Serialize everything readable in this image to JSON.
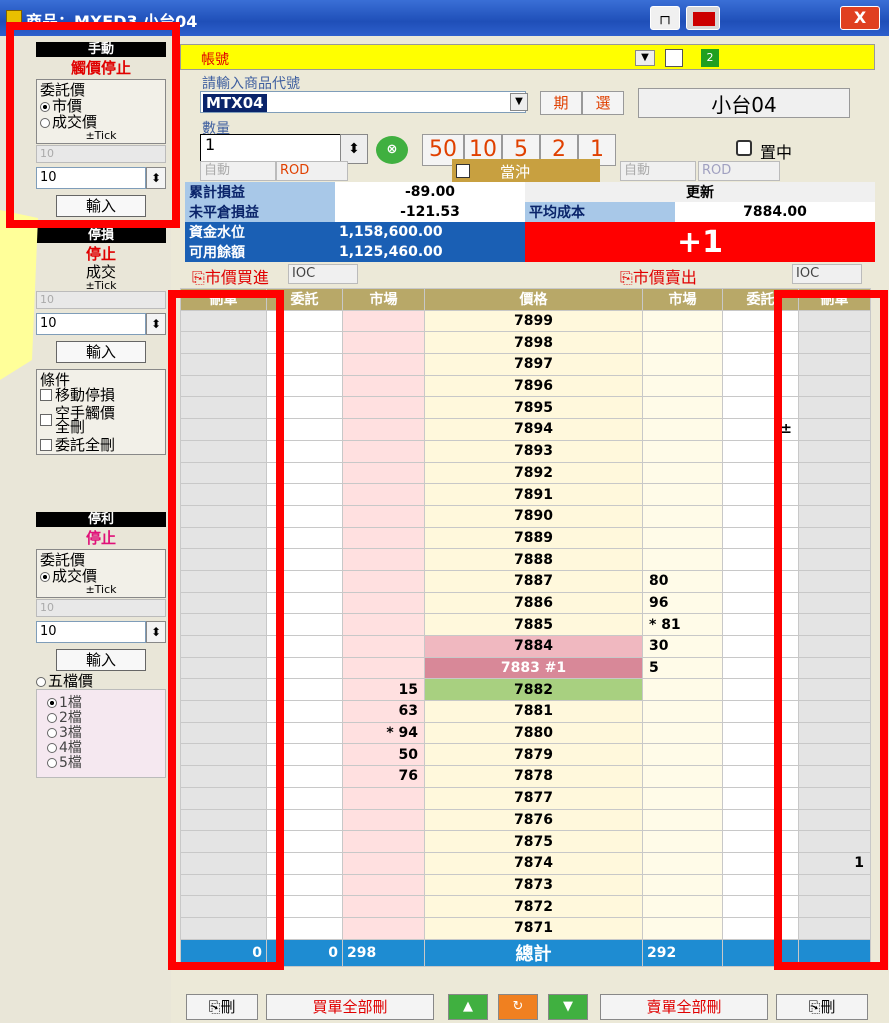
{
  "window": {
    "title": "商品：MXFD3 小台04",
    "pin_label": "",
    "close_label": "X"
  },
  "left": {
    "manual": {
      "header": "手動",
      "sub": "觸價停止",
      "price_caption": "委託價",
      "opt1": "市價",
      "opt2": "成交價",
      "tick": "±Tick",
      "tick_value": "10",
      "step_value": "10",
      "enter": "輸入"
    },
    "stoploss": {
      "header": "停損",
      "sub": "停止",
      "caption": "成交",
      "tick": "±Tick",
      "tick_value": "10",
      "step_value": "10",
      "enter": "輸入",
      "cond_caption": "條件",
      "c1": "移動停損",
      "c2": "空手觸價全刪",
      "c3": "委託全刪"
    },
    "takeprofit": {
      "header": "停利",
      "sub": "停止",
      "price_caption": "委託價",
      "opt1": "成交價",
      "tick": "±Tick",
      "tick_value": "10",
      "step_value": "10",
      "enter": "輸入",
      "opt2": "五檔價",
      "levels": [
        "1檔",
        "2檔",
        "3檔",
        "4檔",
        "5檔"
      ]
    }
  },
  "order": {
    "account_label": "帳號",
    "code_caption": "請輸入商品代號",
    "code_value": "MTX04",
    "btn_period": "期",
    "btn_select": "選",
    "product_name": "小台04",
    "qty_caption": "數量",
    "qty_value": "1",
    "qty_buttons": [
      "50",
      "10",
      "5",
      "2",
      "1"
    ],
    "center_label": "置中",
    "auto1": "自動",
    "rod1": "ROD",
    "daytrade": "當沖",
    "auto2": "自動",
    "rod2": "ROD",
    "stats": {
      "pl_label": "累計損益",
      "pl_value": "-89.00",
      "refresh": "更新",
      "unreal_label": "未平倉損益",
      "unreal_value": "-121.53",
      "avg_label": "平均成本",
      "avg_value": "7884.00",
      "margin_label": "資金水位",
      "margin_value": "1,158,600.00",
      "avail_label": "可用餘額",
      "avail_value": "1,125,460.00",
      "position": "+1"
    },
    "mkt_buy": "市價買進",
    "ioc1": "IOC",
    "mkt_sell": "市價賣出",
    "ioc2": "IOC"
  },
  "book": {
    "headers": [
      "刪單",
      "委託",
      "市場",
      "價格",
      "市場",
      "委託",
      "刪單"
    ],
    "rows": [
      [
        "",
        "",
        "",
        "7899",
        "",
        "",
        ""
      ],
      [
        "",
        "",
        "",
        "7898",
        "",
        "",
        ""
      ],
      [
        "",
        "",
        "",
        "7897",
        "",
        "",
        ""
      ],
      [
        "",
        "",
        "",
        "7896",
        "",
        "",
        ""
      ],
      [
        "",
        "",
        "",
        "7895",
        "",
        "",
        ""
      ],
      [
        "",
        "",
        "",
        "7894",
        "",
        "±",
        ""
      ],
      [
        "",
        "",
        "",
        "7893",
        "",
        "",
        ""
      ],
      [
        "",
        "",
        "",
        "7892",
        "",
        "",
        ""
      ],
      [
        "",
        "",
        "",
        "7891",
        "",
        "",
        ""
      ],
      [
        "",
        "",
        "",
        "7890",
        "",
        "",
        ""
      ],
      [
        "",
        "",
        "",
        "7889",
        "",
        "",
        ""
      ],
      [
        "",
        "",
        "",
        "7888",
        "",
        "",
        ""
      ],
      [
        "",
        "",
        "",
        "7887",
        "80",
        "",
        ""
      ],
      [
        "",
        "",
        "",
        "7886",
        "96",
        "",
        ""
      ],
      [
        "",
        "",
        "",
        "7885",
        "* 81",
        "",
        ""
      ],
      [
        "",
        "",
        "",
        "7884",
        "30",
        "",
        ""
      ],
      [
        "",
        "",
        "",
        "7883 #1",
        "5",
        "",
        ""
      ],
      [
        "",
        "",
        "15",
        "7882",
        "",
        "",
        ""
      ],
      [
        "",
        "",
        "63",
        "7881",
        "",
        "",
        ""
      ],
      [
        "",
        "",
        "* 94",
        "7880",
        "",
        "",
        ""
      ],
      [
        "",
        "",
        "50",
        "7879",
        "",
        "",
        ""
      ],
      [
        "",
        "",
        "76",
        "7878",
        "",
        "",
        ""
      ],
      [
        "",
        "",
        "",
        "7877",
        "",
        "",
        ""
      ],
      [
        "",
        "",
        "",
        "7876",
        "",
        "",
        ""
      ],
      [
        "",
        "",
        "",
        "7875",
        "",
        "",
        ""
      ],
      [
        "",
        "",
        "",
        "7874",
        "",
        "",
        "1"
      ],
      [
        "",
        "",
        "",
        "7873",
        "",
        "",
        ""
      ],
      [
        "",
        "",
        "",
        "7872",
        "",
        "",
        ""
      ],
      [
        "",
        "",
        "",
        "7871",
        "",
        "",
        ""
      ]
    ],
    "totals": [
      "0",
      "0",
      "298",
      "總計",
      "292",
      "",
      ""
    ],
    "bottom": {
      "del_left": "刪",
      "buy_all": "買單全部刪",
      "sell_all": "賣單全部刪",
      "del_right": "刪"
    }
  },
  "colors": {
    "highlight": "#ff0000",
    "title": "#1f4fb8",
    "price_col": "#fff8dc",
    "ask_mkt": "#ffe0e0",
    "totals": "#1e8cd2"
  }
}
